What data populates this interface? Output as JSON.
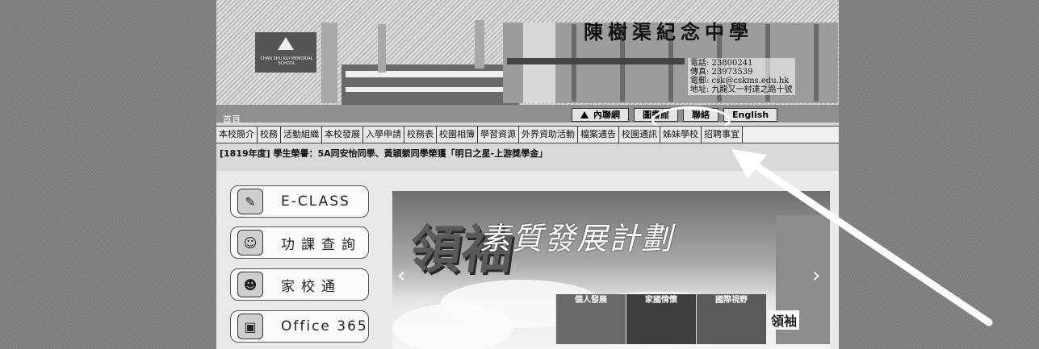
{
  "banner": {
    "school_name": "陳樹渠紀念中學",
    "logo_text": "CHAN SHU KUI MEMORIAL SCHOOL",
    "contact": [
      "電話: 23800241",
      "傳真: 23973539",
      "電郵: csk@cskms.edu.hk",
      "地址: 九龍又一村達之路十號"
    ]
  },
  "toprow": {
    "home": "首頁",
    "links": [
      {
        "label": "內聯網",
        "icon": "house-icon"
      },
      {
        "label": "圖書館"
      },
      {
        "label": "聯絡"
      },
      {
        "label": "English"
      }
    ]
  },
  "mainnav": [
    "本校簡介",
    "校務",
    "活動組織",
    "本校發展",
    "入學申請",
    "校務表",
    "校園相簿",
    "學習資源",
    "外界資助活動",
    "檔案通告",
    "校園通訊",
    "姊妹學校",
    "招聘事宜"
  ],
  "marquee": "[1819年度] 學生榮譽：5A同安怡同學、黃穎縈同學榮獲「明日之星-上游獎學金」",
  "quick_links": [
    {
      "label": "E-CLASS",
      "icon": "eclass-icon",
      "glyph": "✎"
    },
    {
      "label": "功課查詢",
      "icon": "homework-icon",
      "glyph": "☺"
    },
    {
      "label": "家校通",
      "icon": "family-icon",
      "glyph": "☻"
    },
    {
      "label": "Office 365",
      "icon": "office-icon",
      "glyph": "▣"
    }
  ],
  "slideshow": {
    "title": "素質發展計劃",
    "big_text": "領袖",
    "columns": [
      "個人發展",
      "家國情懷",
      "國際視野"
    ],
    "seal": "領袖",
    "prev": "‹",
    "next": "›"
  }
}
